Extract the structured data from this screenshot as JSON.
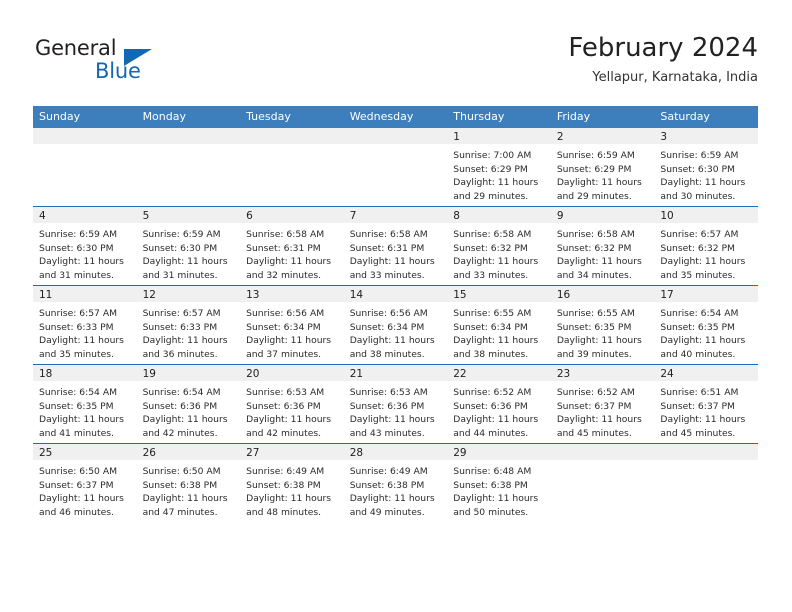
{
  "brand": {
    "name_part1": "General",
    "name_part2": "Blue",
    "color_dark": "#231f20",
    "color_blue": "#1268b3"
  },
  "header": {
    "title": "February 2024",
    "subtitle": "Yellapur, Karnataka, India"
  },
  "theme": {
    "header_bg": "#3d7ebd",
    "row_border": "#1e6eb8",
    "daynum_band": "#f0f0f0"
  },
  "calendar": {
    "weekday_headers": [
      "Sunday",
      "Monday",
      "Tuesday",
      "Wednesday",
      "Thursday",
      "Friday",
      "Saturday"
    ],
    "weeks": [
      [
        {
          "empty": true
        },
        {
          "empty": true
        },
        {
          "empty": true
        },
        {
          "empty": true
        },
        {
          "day": "1",
          "sunrise": "Sunrise: 7:00 AM",
          "sunset": "Sunset: 6:29 PM",
          "daylight1": "Daylight: 11 hours",
          "daylight2": "and 29 minutes."
        },
        {
          "day": "2",
          "sunrise": "Sunrise: 6:59 AM",
          "sunset": "Sunset: 6:29 PM",
          "daylight1": "Daylight: 11 hours",
          "daylight2": "and 29 minutes."
        },
        {
          "day": "3",
          "sunrise": "Sunrise: 6:59 AM",
          "sunset": "Sunset: 6:30 PM",
          "daylight1": "Daylight: 11 hours",
          "daylight2": "and 30 minutes."
        }
      ],
      [
        {
          "day": "4",
          "sunrise": "Sunrise: 6:59 AM",
          "sunset": "Sunset: 6:30 PM",
          "daylight1": "Daylight: 11 hours",
          "daylight2": "and 31 minutes."
        },
        {
          "day": "5",
          "sunrise": "Sunrise: 6:59 AM",
          "sunset": "Sunset: 6:30 PM",
          "daylight1": "Daylight: 11 hours",
          "daylight2": "and 31 minutes."
        },
        {
          "day": "6",
          "sunrise": "Sunrise: 6:58 AM",
          "sunset": "Sunset: 6:31 PM",
          "daylight1": "Daylight: 11 hours",
          "daylight2": "and 32 minutes."
        },
        {
          "day": "7",
          "sunrise": "Sunrise: 6:58 AM",
          "sunset": "Sunset: 6:31 PM",
          "daylight1": "Daylight: 11 hours",
          "daylight2": "and 33 minutes."
        },
        {
          "day": "8",
          "sunrise": "Sunrise: 6:58 AM",
          "sunset": "Sunset: 6:32 PM",
          "daylight1": "Daylight: 11 hours",
          "daylight2": "and 33 minutes."
        },
        {
          "day": "9",
          "sunrise": "Sunrise: 6:58 AM",
          "sunset": "Sunset: 6:32 PM",
          "daylight1": "Daylight: 11 hours",
          "daylight2": "and 34 minutes."
        },
        {
          "day": "10",
          "sunrise": "Sunrise: 6:57 AM",
          "sunset": "Sunset: 6:32 PM",
          "daylight1": "Daylight: 11 hours",
          "daylight2": "and 35 minutes."
        }
      ],
      [
        {
          "day": "11",
          "sunrise": "Sunrise: 6:57 AM",
          "sunset": "Sunset: 6:33 PM",
          "daylight1": "Daylight: 11 hours",
          "daylight2": "and 35 minutes."
        },
        {
          "day": "12",
          "sunrise": "Sunrise: 6:57 AM",
          "sunset": "Sunset: 6:33 PM",
          "daylight1": "Daylight: 11 hours",
          "daylight2": "and 36 minutes."
        },
        {
          "day": "13",
          "sunrise": "Sunrise: 6:56 AM",
          "sunset": "Sunset: 6:34 PM",
          "daylight1": "Daylight: 11 hours",
          "daylight2": "and 37 minutes."
        },
        {
          "day": "14",
          "sunrise": "Sunrise: 6:56 AM",
          "sunset": "Sunset: 6:34 PM",
          "daylight1": "Daylight: 11 hours",
          "daylight2": "and 38 minutes."
        },
        {
          "day": "15",
          "sunrise": "Sunrise: 6:55 AM",
          "sunset": "Sunset: 6:34 PM",
          "daylight1": "Daylight: 11 hours",
          "daylight2": "and 38 minutes."
        },
        {
          "day": "16",
          "sunrise": "Sunrise: 6:55 AM",
          "sunset": "Sunset: 6:35 PM",
          "daylight1": "Daylight: 11 hours",
          "daylight2": "and 39 minutes."
        },
        {
          "day": "17",
          "sunrise": "Sunrise: 6:54 AM",
          "sunset": "Sunset: 6:35 PM",
          "daylight1": "Daylight: 11 hours",
          "daylight2": "and 40 minutes."
        }
      ],
      [
        {
          "day": "18",
          "sunrise": "Sunrise: 6:54 AM",
          "sunset": "Sunset: 6:35 PM",
          "daylight1": "Daylight: 11 hours",
          "daylight2": "and 41 minutes."
        },
        {
          "day": "19",
          "sunrise": "Sunrise: 6:54 AM",
          "sunset": "Sunset: 6:36 PM",
          "daylight1": "Daylight: 11 hours",
          "daylight2": "and 42 minutes."
        },
        {
          "day": "20",
          "sunrise": "Sunrise: 6:53 AM",
          "sunset": "Sunset: 6:36 PM",
          "daylight1": "Daylight: 11 hours",
          "daylight2": "and 42 minutes."
        },
        {
          "day": "21",
          "sunrise": "Sunrise: 6:53 AM",
          "sunset": "Sunset: 6:36 PM",
          "daylight1": "Daylight: 11 hours",
          "daylight2": "and 43 minutes."
        },
        {
          "day": "22",
          "sunrise": "Sunrise: 6:52 AM",
          "sunset": "Sunset: 6:36 PM",
          "daylight1": "Daylight: 11 hours",
          "daylight2": "and 44 minutes."
        },
        {
          "day": "23",
          "sunrise": "Sunrise: 6:52 AM",
          "sunset": "Sunset: 6:37 PM",
          "daylight1": "Daylight: 11 hours",
          "daylight2": "and 45 minutes."
        },
        {
          "day": "24",
          "sunrise": "Sunrise: 6:51 AM",
          "sunset": "Sunset: 6:37 PM",
          "daylight1": "Daylight: 11 hours",
          "daylight2": "and 45 minutes."
        }
      ],
      [
        {
          "day": "25",
          "sunrise": "Sunrise: 6:50 AM",
          "sunset": "Sunset: 6:37 PM",
          "daylight1": "Daylight: 11 hours",
          "daylight2": "and 46 minutes."
        },
        {
          "day": "26",
          "sunrise": "Sunrise: 6:50 AM",
          "sunset": "Sunset: 6:38 PM",
          "daylight1": "Daylight: 11 hours",
          "daylight2": "and 47 minutes."
        },
        {
          "day": "27",
          "sunrise": "Sunrise: 6:49 AM",
          "sunset": "Sunset: 6:38 PM",
          "daylight1": "Daylight: 11 hours",
          "daylight2": "and 48 minutes."
        },
        {
          "day": "28",
          "sunrise": "Sunrise: 6:49 AM",
          "sunset": "Sunset: 6:38 PM",
          "daylight1": "Daylight: 11 hours",
          "daylight2": "and 49 minutes."
        },
        {
          "day": "29",
          "sunrise": "Sunrise: 6:48 AM",
          "sunset": "Sunset: 6:38 PM",
          "daylight1": "Daylight: 11 hours",
          "daylight2": "and 50 minutes."
        },
        {
          "empty": true
        },
        {
          "empty": true
        }
      ]
    ]
  }
}
